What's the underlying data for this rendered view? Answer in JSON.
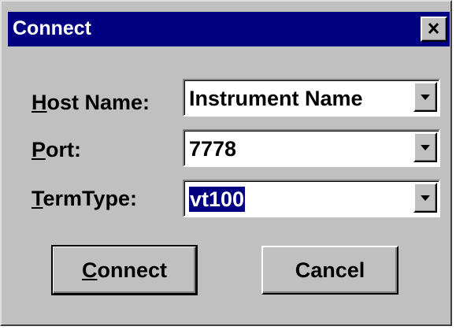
{
  "window": {
    "title": "Connect",
    "close_glyph": "✕"
  },
  "fields": {
    "host": {
      "label_mnemonic": "H",
      "label_rest": "ost Name:",
      "value": "Instrument Name"
    },
    "port": {
      "label_mnemonic": "P",
      "label_rest": "ort:",
      "value": "7778"
    },
    "termtype": {
      "label_mnemonic": "T",
      "label_rest": "ermType:",
      "value": "vt100"
    }
  },
  "buttons": {
    "connect": {
      "mnemonic": "C",
      "rest": "onnect"
    },
    "cancel": {
      "label": "Cancel"
    }
  },
  "colors": {
    "titlebar": "#000080",
    "face": "#c0c0c0",
    "selection": "#000080"
  }
}
